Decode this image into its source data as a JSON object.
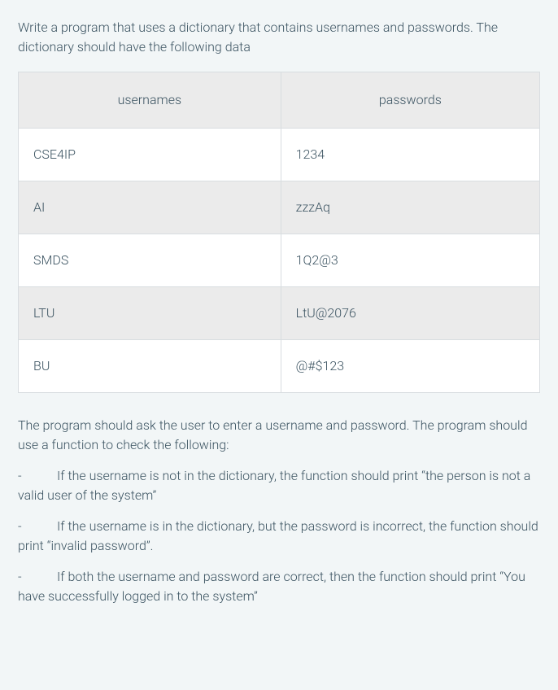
{
  "intro": "Write a program that uses a dictionary that contains usernames and passwords. The dictionary should have the following data",
  "table": {
    "headers": {
      "col1": "usernames",
      "col2": "passwords"
    },
    "rows": [
      {
        "username": "CSE4IP",
        "password": "1234"
      },
      {
        "username": "AI",
        "password": "zzzAq"
      },
      {
        "username": "SMDS",
        "password": "1Q2@3"
      },
      {
        "username": "LTU",
        "password": "LtU@2076"
      },
      {
        "username": "BU",
        "password": "@#$123"
      }
    ]
  },
  "instructions": {
    "lead": "The program should ask the user to enter a username and password. The program should use a function to check the following:",
    "items": [
      "If the username is not in the dictionary, the function should print “the person is not a valid user of the system”",
      "If the username is in the dictionary, but the password is incorrect, the function should print “invalid password”.",
      "If both the username and password are correct, then the function should print “You have successfully logged in to the system”"
    ]
  },
  "bullet_dash": "-"
}
